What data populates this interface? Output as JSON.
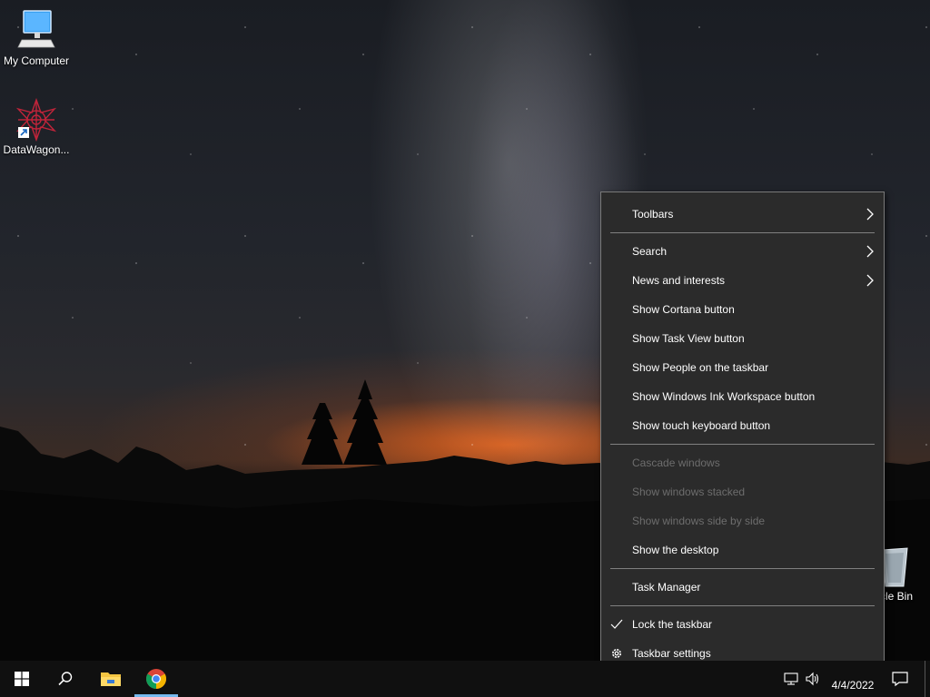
{
  "desktop": {
    "icons": [
      {
        "label": "My Computer",
        "icon": "monitor-icon"
      },
      {
        "label": "DataWagon...",
        "icon": "datawagon-shortcut-icon"
      },
      {
        "label": "Recycle Bin",
        "visible_label": "cle Bin",
        "icon": "recycle-bin-icon"
      }
    ]
  },
  "context_menu": {
    "items": [
      {
        "label": "Toolbars",
        "submenu": true,
        "enabled": true
      },
      {
        "label": "Search",
        "submenu": true,
        "enabled": true
      },
      {
        "label": "News and interests",
        "submenu": true,
        "enabled": true
      },
      {
        "label": "Show Cortana button",
        "enabled": true
      },
      {
        "label": "Show Task View button",
        "enabled": true
      },
      {
        "label": "Show People on the taskbar",
        "enabled": true
      },
      {
        "label": "Show Windows Ink Workspace button",
        "enabled": true
      },
      {
        "label": "Show touch keyboard button",
        "enabled": true
      },
      {
        "label": "Cascade windows",
        "enabled": false
      },
      {
        "label": "Show windows stacked",
        "enabled": false
      },
      {
        "label": "Show windows side by side",
        "enabled": false
      },
      {
        "label": "Show the desktop",
        "enabled": true
      },
      {
        "label": "Task Manager",
        "enabled": true
      },
      {
        "label": "Lock the taskbar",
        "enabled": true,
        "checked": true
      },
      {
        "label": "Taskbar settings",
        "enabled": true,
        "icon": "gear-icon"
      }
    ]
  },
  "taskbar": {
    "buttons": [
      {
        "name": "start",
        "icon": "windows-start-icon"
      },
      {
        "name": "search",
        "icon": "search-icon"
      },
      {
        "name": "file-explorer",
        "icon": "folder-icon"
      },
      {
        "name": "chrome",
        "icon": "chrome-icon"
      }
    ],
    "tray": {
      "network_icon": "network-icon",
      "volume_icon": "volume-icon",
      "date": "4/4/2022",
      "notification_icon": "notification-icon"
    }
  },
  "colors": {
    "menu_bg": "#2b2b2b",
    "menu_border": "#7a7a7a",
    "menu_text": "#ffffff",
    "menu_disabled_text": "#6d6d6d",
    "taskbar_bg": "#101010",
    "folder_yellow": "#f4c542",
    "monitor_blue": "#3aa0f0"
  }
}
